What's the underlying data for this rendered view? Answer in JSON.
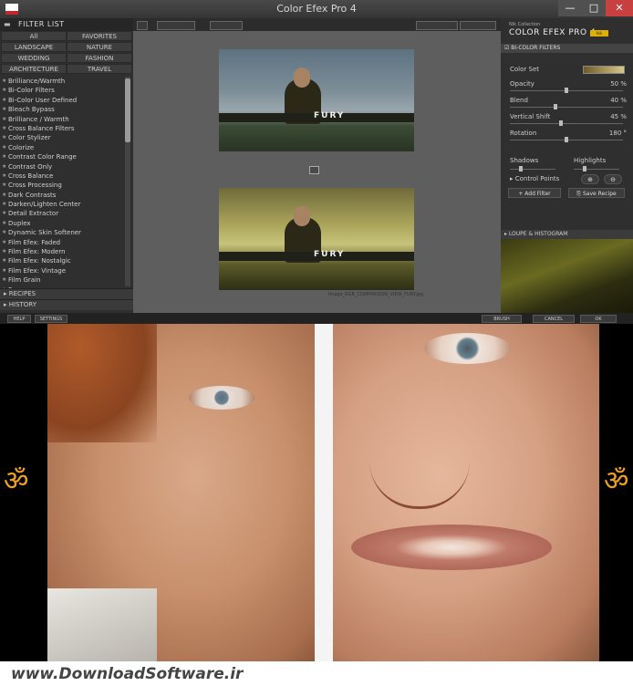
{
  "window": {
    "title": "Color Efex Pro 4",
    "minimize_label": "—",
    "maximize_label": "□",
    "close_label": "✕"
  },
  "filter_panel": {
    "header": "FILTER LIST",
    "categories": [
      "All",
      "FAVORITES",
      "LANDSCAPE",
      "NATURE",
      "WEDDING",
      "FASHION",
      "ARCHITECTURE",
      "TRAVEL"
    ],
    "filters": [
      "Brilliance/Warmth",
      "Bi-Color Filters",
      "Bi-Color User Defined",
      "Bleach Bypass",
      "Brilliance / Warmth",
      "Cross Balance Filters",
      "Color Stylizer",
      "Colorize",
      "Contrast Color Range",
      "Contrast Only",
      "Cross Balance",
      "Cross Processing",
      "Dark Contrasts",
      "Darken/Lighten Center",
      "Detail Extractor",
      "Duplex",
      "Dynamic Skin Softener",
      "Film Efex: Faded",
      "Film Efex: Modern",
      "Film Efex: Nostalgic",
      "Film Efex: Vintage",
      "Film Grain",
      "Fog"
    ],
    "recipes_label": "RECIPES",
    "history_label": "HISTORY"
  },
  "preview": {
    "top_word": "FURY",
    "bottom_word": "FURY",
    "caption": "Image_RGB_COMPARISON_VIEW_FURY.jpg"
  },
  "right_panel": {
    "brand_small": "Nik Collection",
    "brand_main": "COLOR EFEX PRO 4",
    "brand_badge": "Nik",
    "filter_header": "BI-COLOR FILTERS",
    "color_set_label": "Color Set",
    "rows": [
      {
        "label": "Opacity",
        "value": "50 %",
        "level": 0.5
      },
      {
        "label": "Blend",
        "value": "40 %",
        "level": 0.4
      },
      {
        "label": "Vertical Shift",
        "value": "45 %",
        "level": 0.45
      },
      {
        "label": "Rotation",
        "value": "180 °",
        "level": 0.5
      }
    ],
    "shadows_label": "Shadows",
    "highlights_label": "Highlights",
    "control_points_label": "Control Points",
    "add_filter_label": "Add Filter",
    "save_recipe_label": "Save Recipe",
    "loupe_label": "LOUPE & HISTOGRAM"
  },
  "bottom_bar": {
    "help_label": "HELP",
    "settings_label": "SETTINGS",
    "brush_label": "BRUSH",
    "cancel_label": "CANCEL",
    "ok_label": "OK"
  },
  "faces": {
    "left_glyph": "ॐ",
    "right_glyph": "ॐ"
  },
  "footer": {
    "site": "www.DownloadSoftware.ir"
  },
  "colors": {
    "accent_close": "#c94040",
    "app_bg": "#3a3a3a",
    "glyph": "#f0a020"
  }
}
